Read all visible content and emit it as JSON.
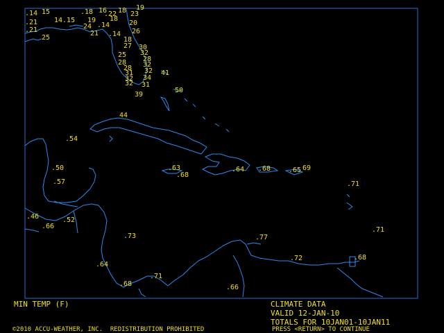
{
  "map": {
    "border_color": "#2a6fd6",
    "coast_color": "#2a8cf0",
    "text_color": "#f0e020",
    "background": "#000000"
  },
  "temperatures": [
    ".14",
    "15",
    ".21",
    ".21",
    "25",
    "14.15",
    ".18",
    "16",
    ".22",
    "18",
    "19",
    "23",
    "19",
    "18",
    "20",
    "24",
    ".14",
    "21",
    ".14",
    "26",
    "18",
    "27",
    "30",
    "25",
    "32",
    "28",
    "28",
    "32",
    "28",
    "31",
    "32",
    "41",
    "32",
    "34",
    "32",
    "31",
    "39",
    "50",
    "44",
    ".54",
    ".50",
    ".57",
    ".46",
    ".66",
    ".52",
    ".63",
    ".68",
    ".64",
    ".68",
    ".65",
    "69",
    ".71",
    ".73",
    ".71",
    ".77",
    ".64",
    ".68",
    ".71",
    ".72",
    ".68",
    ".66"
  ],
  "footer": {
    "left_title": "MIN TEMP (F)",
    "right_line1": "CLIMATE DATA",
    "right_line2": "VALID 12-JAN-10",
    "right_line3": "TOTALS FOR 10JAN01-10JAN11",
    "copyright": "©2010 ACCU-WEATHER, INC.  REDISTRIBUTION PROHIBITED",
    "continue_prompt": "PRESS <RETURN> TO CONTINUE"
  }
}
